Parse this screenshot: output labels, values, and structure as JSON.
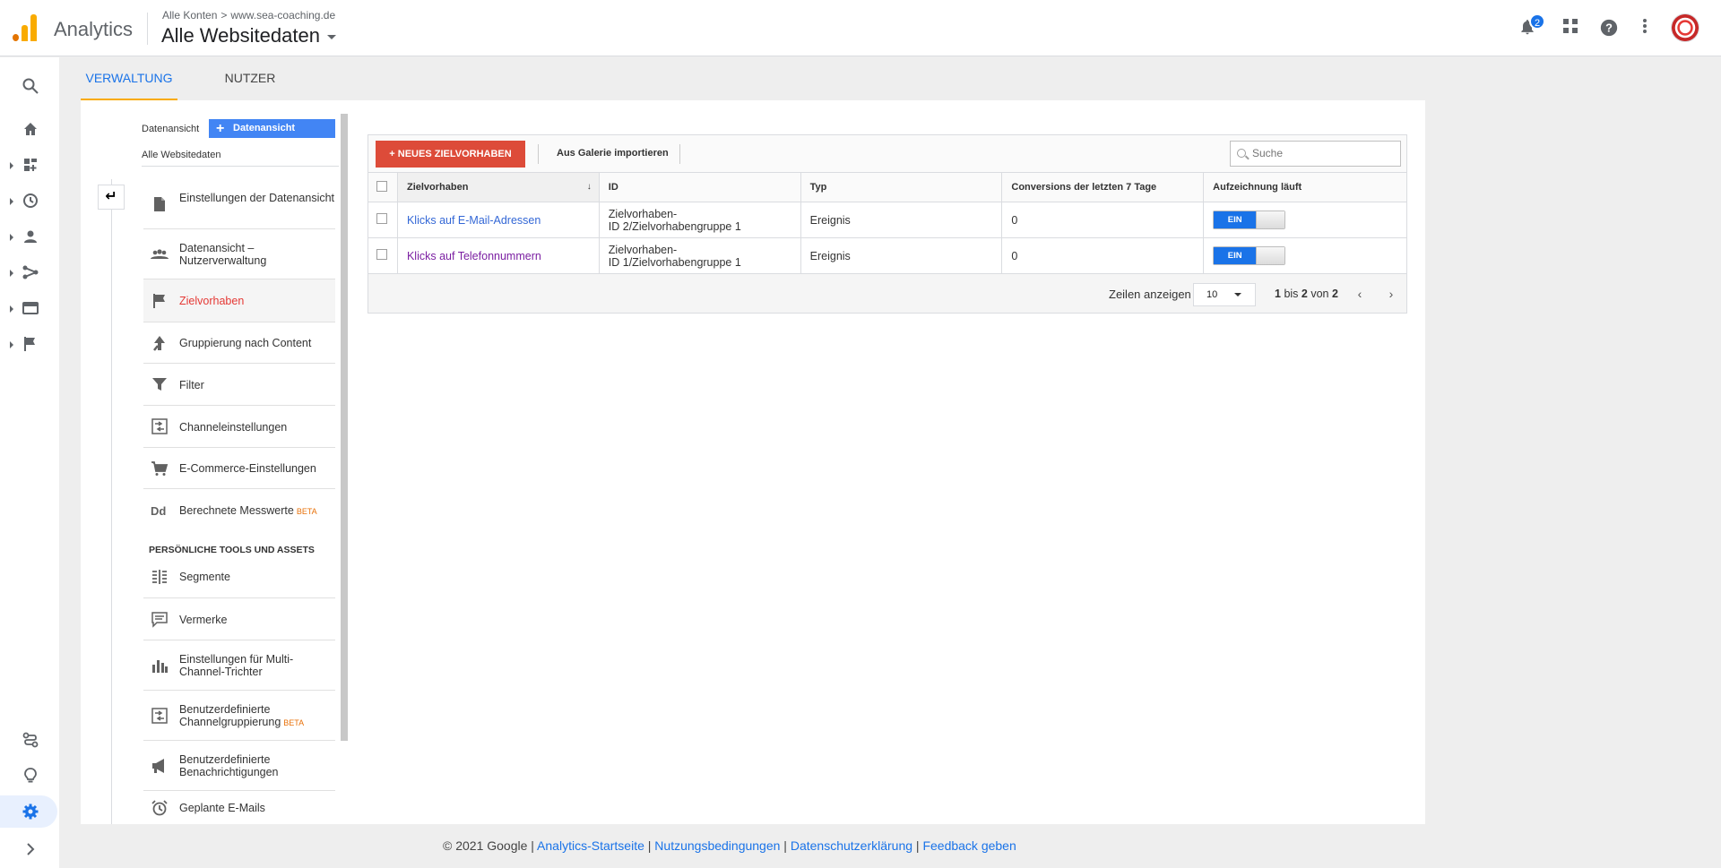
{
  "header": {
    "app_name": "Analytics",
    "breadcrumb_account": "Alle Konten",
    "breadcrumb_property": "www.sea-coaching.de",
    "view_name": "Alle Websitedaten",
    "notification_count": "2"
  },
  "tabs": [
    {
      "label": "VERWALTUNG",
      "active": true
    },
    {
      "label": "NUTZER",
      "active": false
    }
  ],
  "admin": {
    "view_label": "Datenansicht",
    "create_view_label": "Datenansicht erstellen",
    "current_view": "Alle Websitedaten",
    "section_title": "PERSÖNLICHE TOOLS UND ASSETS",
    "beta_label": "BETA",
    "items": [
      {
        "label": "Einstellungen der Datenansicht",
        "icon": "document-icon"
      },
      {
        "label": "Datenansicht – Nutzerverwaltung",
        "icon": "people-icon"
      },
      {
        "label": "Zielvorhaben",
        "icon": "flag-icon",
        "active": true
      },
      {
        "label": "Gruppierung nach Content",
        "icon": "content-grouping-icon"
      },
      {
        "label": "Filter",
        "icon": "filter-icon"
      },
      {
        "label": "Channeleinstellungen",
        "icon": "channel-settings-icon"
      },
      {
        "label": "E-Commerce-Einstellungen",
        "icon": "cart-icon"
      },
      {
        "label": "Berechnete Messwerte",
        "icon": "dd-icon",
        "beta": true
      },
      {
        "label": "Segmente",
        "icon": "segments-icon"
      },
      {
        "label": "Vermerke",
        "icon": "annotation-icon"
      },
      {
        "label": "Einstellungen für Multi-Channel-Trichter",
        "icon": "bar-chart-icon"
      },
      {
        "label": "Benutzerdefinierte Channelgruppierung",
        "icon": "channel-grouping-icon",
        "beta": true
      },
      {
        "label": "Benutzerdefinierte Benachrichtigungen",
        "icon": "megaphone-icon"
      },
      {
        "label": "Geplante E-Mails",
        "icon": "alarm-clock-icon"
      }
    ]
  },
  "goals": {
    "new_button": "+ NEUES ZIELVORHABEN",
    "import_button": "Aus Galerie importieren",
    "search_placeholder": "Suche",
    "columns": [
      "Zielvorhaben",
      "ID",
      "Typ",
      "Conversions der letzten 7 Tage",
      "Aufzeichnung läuft"
    ],
    "rows": [
      {
        "name": "Klicks auf E-Mail-Adressen",
        "id_line1": "Zielvorhaben-",
        "id_line2": "ID 2/Zielvorhabengruppe 1",
        "type": "Ereignis",
        "conversions": "0",
        "recording": "EIN"
      },
      {
        "name": "Klicks auf Telefonnummern",
        "id_line1": "Zielvorhaben-",
        "id_line2": "ID 1/Zielvorhabengruppe 1",
        "type": "Ereignis",
        "conversions": "0",
        "recording": "EIN"
      }
    ],
    "pager": {
      "rows_label": "Zeilen anzeigen",
      "rows_value": "10",
      "from": "1",
      "to_word": "bis",
      "to": "2",
      "of_word": "von",
      "total": "2"
    }
  },
  "footer": {
    "copyright": "© 2021 Google",
    "links": [
      "Analytics-Startseite",
      "Nutzungsbedingungen",
      "Datenschutzerklärung",
      "Feedback geben"
    ]
  },
  "colors": {
    "accent": "#1a73e8",
    "new_button": "#dd4b39",
    "active_menu": "#e53935",
    "tab_underline": "#f9ab00"
  }
}
